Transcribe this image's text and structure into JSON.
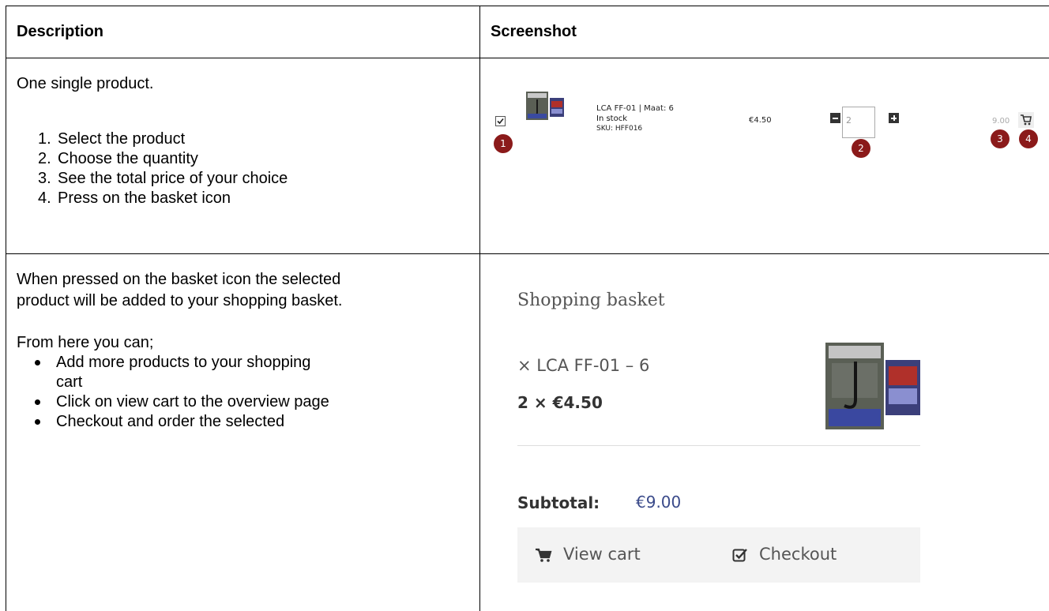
{
  "table": {
    "header_description": "Description",
    "header_screenshot": "Screenshot"
  },
  "row1": {
    "intro": "One single product.",
    "steps": [
      {
        "num": "1.",
        "text": "Select the product"
      },
      {
        "num": "2.",
        "text": "Choose the quantity"
      },
      {
        "num": "3.",
        "text": "See the total price of your choice"
      },
      {
        "num": "4.",
        "text": "Press on the basket icon"
      }
    ],
    "shot": {
      "product_name": "LCA FF-01 | Maat: 6",
      "stock": "In stock",
      "sku": "SKU: HFF016",
      "price": "€4.50",
      "quantity": "2",
      "total": "9.00",
      "checkbox_checked": true,
      "badges": [
        "1",
        "2",
        "3",
        "4"
      ],
      "badge_color": "#8b1a1a"
    }
  },
  "row2": {
    "line1": "When pressed on the basket icon the selected",
    "line2": "product will be added to your shopping basket.",
    "from_here": "From here you can;",
    "bullets": [
      {
        "line1": "Add more products to your shopping",
        "line2": "cart"
      },
      {
        "line1": "Click on view cart to the overview page",
        "line2": ""
      },
      {
        "line1": "Checkout and order the selected",
        "line2": ""
      }
    ],
    "shot": {
      "title": "Shopping basket",
      "item": "× LCA FF-01 – 6",
      "qty_price": "2 × €4.50",
      "subtotal_label": "Subtotal:",
      "subtotal_value": "€9.00",
      "view_cart": "View cart",
      "checkout": "Checkout",
      "price_color": "#3a4a8a"
    }
  }
}
